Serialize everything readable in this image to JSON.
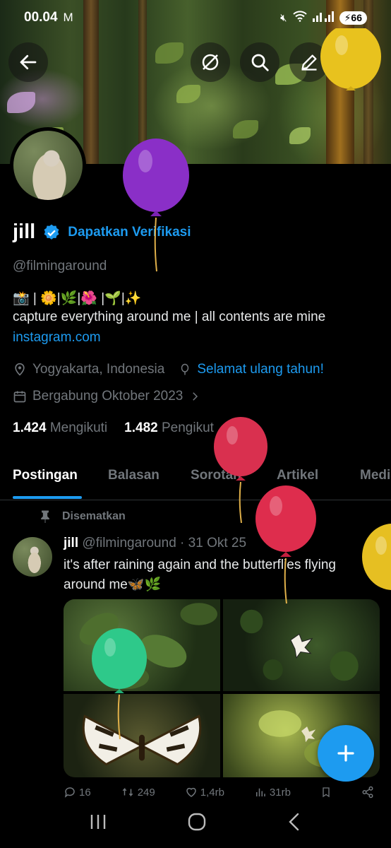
{
  "status_bar": {
    "time": "00.04",
    "mail_icon": "gmail-icon",
    "battery": "66"
  },
  "profile": {
    "name": "jill",
    "verification_cta": "Dapatkan Verifikasi",
    "handle": "@filmingaround",
    "bio_emoji_line": "📸 | 🌼|🌿|🌺 |🌱|✨",
    "bio_text": "capture everything around me | all contents are mine",
    "link": "instagram.com",
    "location": "Yogyakarta, Indonesia",
    "birthday": "Selamat ulang tahun!",
    "joined": "Bergabung Oktober 2023",
    "following_count": "1.424",
    "following_label": "Mengikuti",
    "followers_count": "1.482",
    "followers_label": "Pengikut"
  },
  "tabs": [
    "Postingan",
    "Balasan",
    "Sorotan",
    "Artikel",
    "Media"
  ],
  "active_tab": "Postingan",
  "post": {
    "pinned_label": "Disematkan",
    "author": "jill",
    "handle": "@filmingaround",
    "date": "· 31 Okt 25",
    "text": "it's after raining again and the butterflies flying around me🦋🌿",
    "replies": "16",
    "reposts": "249",
    "likes": "1,4rb",
    "views": "31rb"
  },
  "colors": {
    "accent": "#1d9bf0",
    "muted": "#71767b",
    "background": "#000000"
  },
  "balloons": [
    {
      "color": "#8a2fc7"
    },
    {
      "color": "#e8c21e"
    },
    {
      "color": "#d9304f"
    },
    {
      "color": "#de2d4d"
    },
    {
      "color": "#e6bf22"
    },
    {
      "color": "#2ec98a"
    }
  ]
}
